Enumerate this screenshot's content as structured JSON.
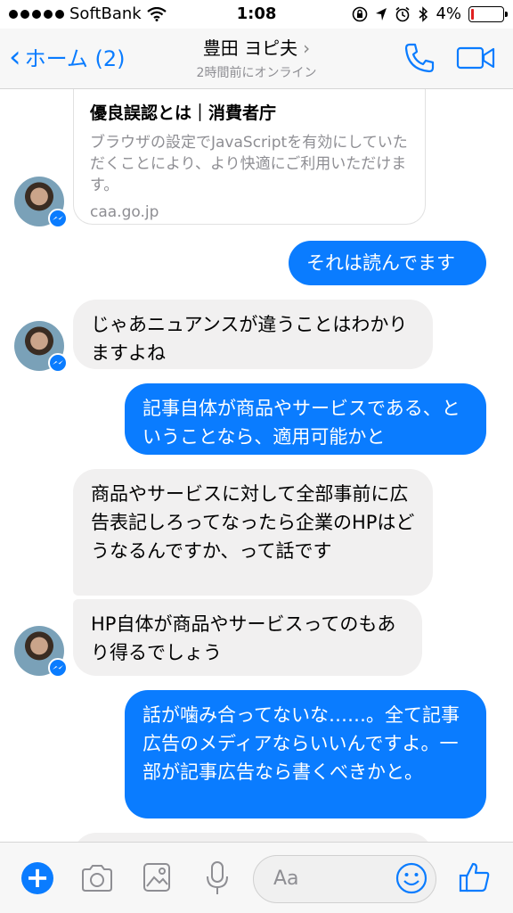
{
  "status_bar": {
    "carrier": "SoftBank",
    "time": "1:08",
    "battery_percent": "4%",
    "battery_level": 0.04
  },
  "nav": {
    "back_label": "ホーム (2)",
    "contact_name": "豊田 ヨピ夫",
    "contact_status": "2時間前にオンライン"
  },
  "link_card": {
    "title": "優良誤認とは｜消費者庁",
    "description": "ブラウザの設定でJavaScriptを有効にしていただくことにより、より快適にご利用いただけます。",
    "domain": "caa.go.jp"
  },
  "messages": [
    {
      "direction": "out",
      "text": "それは読んでます"
    },
    {
      "direction": "in",
      "text": "じゃあニュアンスが違うことはわかりますよね"
    },
    {
      "direction": "out",
      "text": "記事自体が商品やサービスである、ということなら、適用可能かと"
    },
    {
      "direction": "in",
      "text": "商品やサービスに対して全部事前に広告表記しろってなったら企業のHPはどうなるんですか、って話です"
    },
    {
      "direction": "in",
      "text": "HP自体が商品やサービスってのもあり得るでしょう"
    },
    {
      "direction": "out",
      "text": "話が噛み合ってないな……。全て記事広告のメディアならいいんですよ。一部が記事広告なら書くべきかと。"
    }
  ],
  "composer": {
    "placeholder": "Aa"
  },
  "colors": {
    "accent": "#0a7cff",
    "incoming_bubble": "#f1f0f0",
    "battery_low": "#e02020"
  }
}
